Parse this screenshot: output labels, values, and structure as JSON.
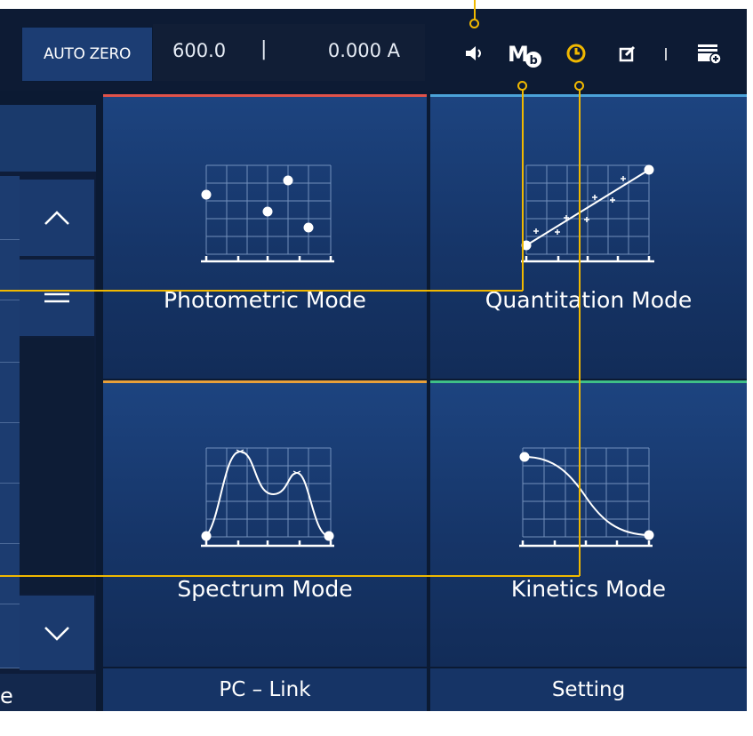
{
  "topbar": {
    "auto_zero_label": "AUTO ZERO",
    "wavelength": "600.0",
    "separator": "|",
    "absorbance": "0.000 A",
    "icons": [
      "speaker-icon",
      "mode-memory-icon",
      "timer-icon",
      "edit-icon",
      "folder-add-icon"
    ]
  },
  "left_panel": {
    "scroll_up_icon": "chevron-up-icon",
    "scroll_mid_icon": "equals-icon",
    "scroll_down_icon": "chevron-down-icon",
    "bottom_label_partial": "e"
  },
  "tiles": [
    {
      "label": "Photometric Mode",
      "accent": "#e0524a"
    },
    {
      "label": "Quantitation Mode",
      "accent": "#4ba3d9"
    },
    {
      "label": "Spectrum Mode",
      "accent": "#e8a03a"
    },
    {
      "label": "Kinetics Mode",
      "accent": "#3fbf86"
    }
  ],
  "bottom": {
    "pc_link": "PC – Link",
    "setting": "Setting"
  },
  "colors": {
    "annotation": "#f0b800",
    "timer_icon": "#f0b800"
  }
}
